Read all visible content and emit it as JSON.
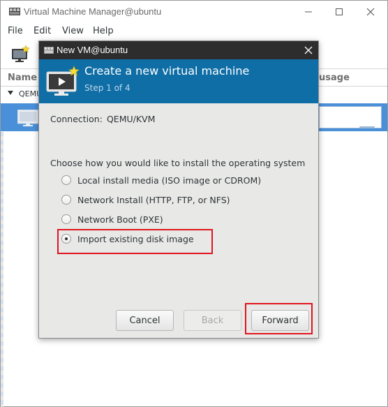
{
  "main_window": {
    "title": "Virtual Machine Manager@ubuntu",
    "menu": [
      "File",
      "Edit",
      "View",
      "Help"
    ],
    "columns": {
      "name": "Name",
      "usage": "usage"
    },
    "group_label": "QEMU"
  },
  "dialog": {
    "title": "New VM@ubuntu",
    "header_title": "Create a new virtual machine",
    "header_step": "Step 1 of 4",
    "connection_label": "Connection:",
    "connection_value": "QEMU/KVM",
    "install_prompt": "Choose how you would like to install the operating system",
    "options": [
      {
        "label": "Local install media (ISO image or CDROM)",
        "selected": false
      },
      {
        "label": "Network Install (HTTP, FTP, or NFS)",
        "selected": false
      },
      {
        "label": "Network Boot (PXE)",
        "selected": false
      },
      {
        "label": "Import existing disk image",
        "selected": true
      }
    ],
    "buttons": {
      "cancel": "Cancel",
      "back": "Back",
      "forward": "Forward"
    },
    "back_enabled": false
  },
  "colors": {
    "header_blue": "#0f6ea6",
    "selection_blue": "#4a90d9",
    "dialog_titlebar": "#2d2d2d",
    "highlight_red": "#e0141e"
  },
  "icons": {
    "app": "vm-manager-icon",
    "new_vm": "new-vm-monitor-icon",
    "vm": "vm-monitor-icon",
    "wizard": "wizard-monitor-play-icon"
  }
}
